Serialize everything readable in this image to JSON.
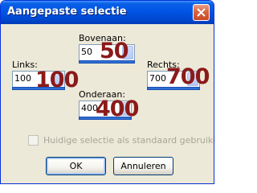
{
  "window": {
    "title": "Aangepaste selectie"
  },
  "fields": {
    "top": {
      "label": "Bovenaan:",
      "value": "50",
      "big": "50"
    },
    "left": {
      "label": "Links:",
      "value": "100",
      "big": "100"
    },
    "right": {
      "label": "Rechts:",
      "value": "700",
      "big": "700"
    },
    "bottom": {
      "label": "Onderaan:",
      "value": "400",
      "big": "400"
    }
  },
  "checkbox": {
    "label": "Huidige selectie als standaard gebruiken",
    "checked": false
  },
  "buttons": {
    "ok": "OK",
    "cancel": "Annuleren"
  },
  "icons": [
    "close-icon",
    "spin-arrows-icon"
  ],
  "colors": {
    "titlebar": "#0055e5",
    "overlay_text": "#8b1a1a",
    "window_bg": "#ece9d8"
  }
}
